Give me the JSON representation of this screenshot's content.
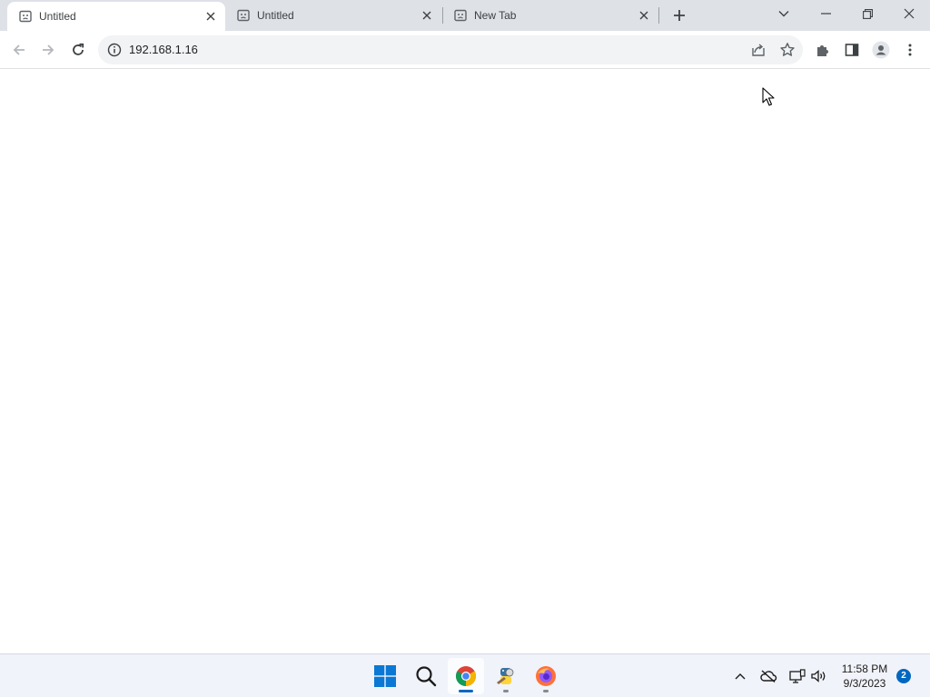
{
  "browser": {
    "tabs": [
      {
        "title": "Untitled",
        "active": true
      },
      {
        "title": "Untitled",
        "active": false
      },
      {
        "title": "New Tab",
        "active": false
      }
    ],
    "address_bar": {
      "url": "192.168.1.16"
    },
    "icons": {
      "back": "arrow-left-icon",
      "forward": "arrow-right-icon",
      "reload": "reload-icon",
      "site_info": "info-icon",
      "share": "share-icon",
      "bookmark": "star-icon",
      "extensions": "puzzle-icon",
      "side_panel": "side-panel-icon",
      "profile": "profile-icon",
      "menu": "kebab-menu-icon"
    }
  },
  "taskbar": {
    "apps": [
      "windows-start",
      "search",
      "chrome",
      "python-app",
      "firefox"
    ],
    "clock": {
      "time": "11:58 PM",
      "date": "9/3/2023"
    },
    "notification_count": "2"
  },
  "colors": {
    "tabstrip_bg": "#dee1e6",
    "omnibox_bg": "#f1f3f4",
    "taskbar_bg": "#f0f3f9",
    "accent": "#0067c0"
  }
}
